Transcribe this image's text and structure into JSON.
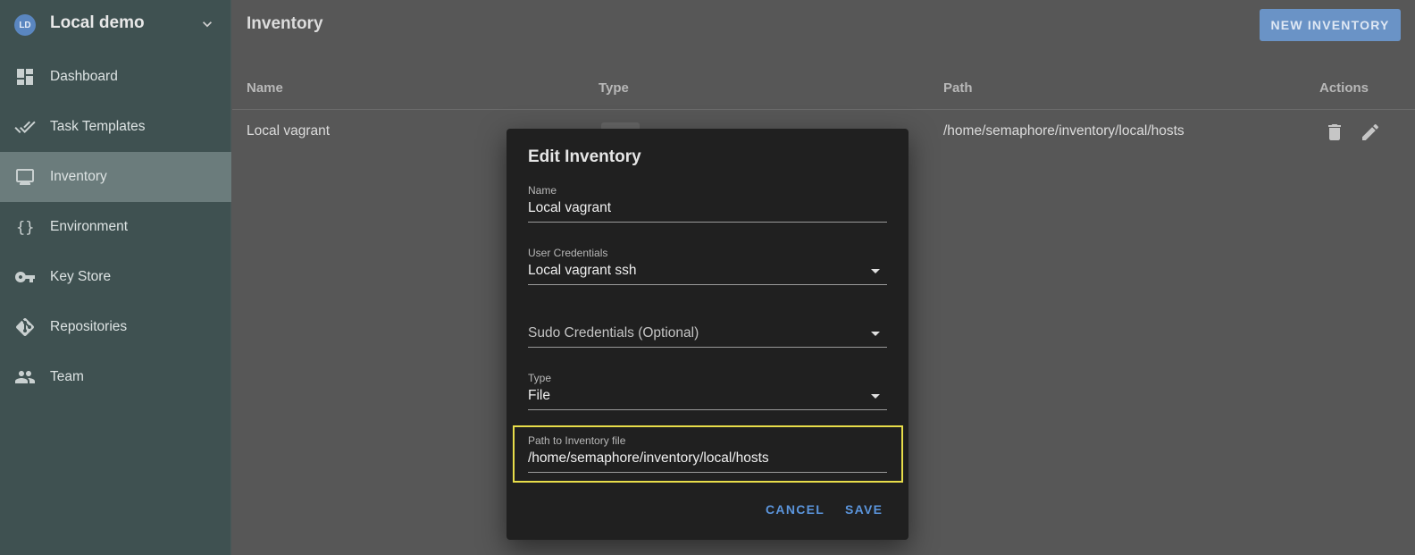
{
  "sidebar": {
    "project": {
      "initials": "LD",
      "name": "Local demo"
    },
    "items": [
      {
        "label": "Dashboard",
        "icon": "dashboard-icon",
        "active": false
      },
      {
        "label": "Task Templates",
        "icon": "double-check-icon",
        "active": false
      },
      {
        "label": "Inventory",
        "icon": "monitor-icon",
        "active": true
      },
      {
        "label": "Environment",
        "icon": "braces-icon",
        "active": false
      },
      {
        "label": "Key Store",
        "icon": "key-icon",
        "active": false
      },
      {
        "label": "Repositories",
        "icon": "git-icon",
        "active": false
      },
      {
        "label": "Team",
        "icon": "people-icon",
        "active": false
      }
    ]
  },
  "main": {
    "title": "Inventory",
    "new_button": "NEW INVENTORY",
    "table": {
      "columns": [
        "Name",
        "Type",
        "Path",
        "Actions"
      ],
      "rows": [
        {
          "name": "Local vagrant",
          "path": "/home/semaphore/inventory/local/hosts"
        }
      ]
    }
  },
  "dialog": {
    "title": "Edit Inventory",
    "name": {
      "label": "Name",
      "value": "Local vagrant"
    },
    "user_credentials": {
      "label": "User Credentials",
      "value": "Local vagrant ssh"
    },
    "sudo_credentials": {
      "placeholder": "Sudo Credentials (Optional)"
    },
    "type": {
      "label": "Type",
      "value": "File"
    },
    "path": {
      "label": "Path to Inventory file",
      "value": "/home/semaphore/inventory/local/hosts"
    },
    "cancel": "CANCEL",
    "save": "SAVE"
  },
  "colors": {
    "sidebar_bg": "#3f5151",
    "active_nav": "#6b7c7c",
    "accent": "#5b95dc",
    "highlight": "#e8dd4a"
  }
}
